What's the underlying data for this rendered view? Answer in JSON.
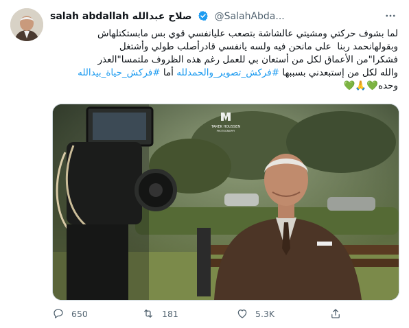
{
  "author": {
    "display_name": "salah abdallah صلاح عبدالله",
    "handle": "@SalahAbda..."
  },
  "tweet": {
    "line1": "لما بشوف حركتي ومشيتي عالشاشة بتصعب عليانفسي قوي بس مابستكتلهاش",
    "line2": "وبقولهانحمد ربنا  على مانحن فيه ولسه يانفسي قادرأصلب طولي وأشتغل",
    "line3": "فشكرا\"من الأعماق لكل من أستعان بي للعمل رغم هذه الظروف ملتمسا\"العذر",
    "line4_start": "والله لكل من إستبعدني بسببها ",
    "hashtag1": "#فركش_تصوير_والحمدلله",
    "line4_mid": " أما ",
    "hashtag2": "#فركش_حياة_بيدالله",
    "line5": "وحده💚🙏💚"
  },
  "media": {
    "watermark_name": "TAREK HOUSSEN",
    "watermark_sub": "PHOTOGRAPHY"
  },
  "actions": {
    "replies": "650",
    "retweets": "181",
    "likes": "5.3K"
  },
  "colors": {
    "accent": "#1d9bf0",
    "muted": "#536471",
    "text": "#0f1419"
  }
}
